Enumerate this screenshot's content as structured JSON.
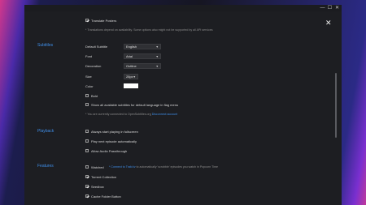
{
  "window": {
    "controls": {
      "minimize": "—",
      "maximize": "☐",
      "close": "✕"
    }
  },
  "top": {
    "translate_posters_label": "Translate Posters",
    "translate_note": "* Translations depend on availability. Some options also might not be supported by all API services"
  },
  "subtitles": {
    "section_title": "Subtitles",
    "default_subtitle": {
      "label": "Default Subtitle",
      "value": "English"
    },
    "font": {
      "label": "Font",
      "value": "Arial"
    },
    "decoration": {
      "label": "Decoration",
      "value": "Outline"
    },
    "size": {
      "label": "Size",
      "value": "28px"
    },
    "color": {
      "label": "Color",
      "value": "#ffffff"
    },
    "bold_label": "Bold",
    "show_all_label": "Show all available subtitles for default language in flag menu",
    "connected_note": "* You are currently connected to OpenSubtitles.org",
    "disconnect_link": "Disconnect account"
  },
  "playback": {
    "section_title": "Playback",
    "always_fullscreen_label": "Always start playing in fullscreen",
    "play_next_label": "Play next episode automatically",
    "audio_passthrough_label": "Allow Audio Passthrough"
  },
  "features": {
    "section_title": "Features",
    "watched_label": "Watched",
    "watched_note_link": "* Connect to Trakt.tv",
    "watched_note_rest": "to automatically 'scrobble' episodes you watch in Popcorn Time",
    "torrent_collection_label": "Torrent Collection",
    "seedbox_label": "Seedbox",
    "cache_folder_label": "Cache Folder Button"
  }
}
